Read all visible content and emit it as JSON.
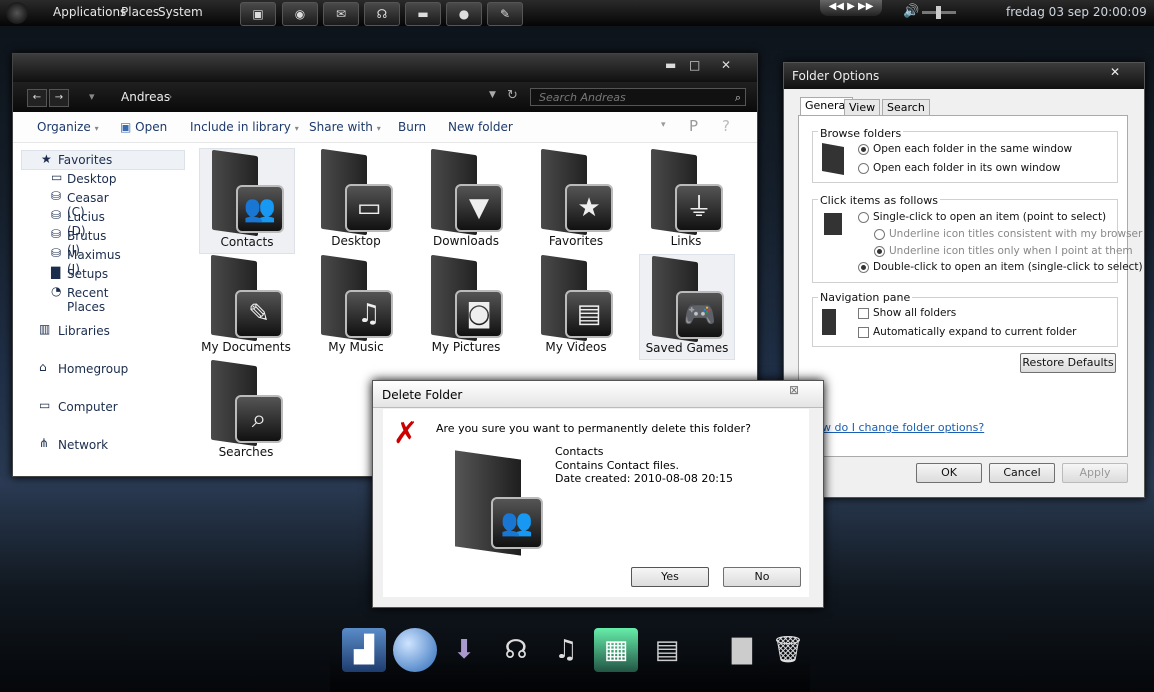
{
  "panel": {
    "menus": [
      "Applications",
      "Places",
      "System"
    ],
    "launcher_icons": [
      "home-folder-icon",
      "firefox-icon",
      "mail-icon",
      "headphones-icon",
      "folder-icon",
      "chat-icon",
      "tool-icon"
    ],
    "clock": "fredag 03 sep  20:00:09"
  },
  "explorer": {
    "breadcrumb": "Andreas",
    "search_placeholder": "Search Andreas",
    "commands": [
      "Organize",
      "Open",
      "Include in library",
      "Share with",
      "Burn",
      "New folder"
    ],
    "nav": {
      "favorites": "Favorites",
      "favorites_items": [
        "Desktop",
        "Ceasar (C)",
        "Lucius (D)",
        "Brutus (I)",
        "Maximus (J)",
        "Setups",
        "Recent Places"
      ],
      "libraries": "Libraries",
      "homegroup": "Homegroup",
      "computer": "Computer",
      "network": "Network"
    },
    "folders": [
      {
        "label": "Contacts",
        "icon": "people"
      },
      {
        "label": "Desktop",
        "icon": "monitor"
      },
      {
        "label": "Downloads",
        "icon": "download"
      },
      {
        "label": "Favorites",
        "icon": "star"
      },
      {
        "label": "Links",
        "icon": "plug"
      },
      {
        "label": "My Documents",
        "icon": "pen"
      },
      {
        "label": "My Music",
        "icon": "note"
      },
      {
        "label": "My Pictures",
        "icon": "camera"
      },
      {
        "label": "My Videos",
        "icon": "clapper"
      },
      {
        "label": "Saved Games",
        "icon": "gamepad"
      },
      {
        "label": "Searches",
        "icon": "magnifier"
      }
    ]
  },
  "folder_options": {
    "title": "Folder Options",
    "tabs": [
      "General",
      "View",
      "Search"
    ],
    "browse": {
      "title": "Browse folders",
      "opt1": "Open each folder in the same window",
      "opt2": "Open each folder in its own window"
    },
    "click": {
      "title": "Click items as follows",
      "opt1": "Single-click to open an item (point to select)",
      "sub1": "Underline icon titles consistent with my browser",
      "sub2": "Underline icon titles only when I point at them",
      "opt2": "Double-click to open an item (single-click to select)"
    },
    "navpane": {
      "title": "Navigation pane",
      "opt1": "Show all folders",
      "opt2": "Automatically expand to current folder"
    },
    "restore": "Restore Defaults",
    "help_link": "w do I change folder options?",
    "ok": "OK",
    "cancel": "Cancel",
    "apply": "Apply"
  },
  "delete_dialog": {
    "title": "Delete Folder",
    "question": "Are you sure you want to permanently delete this folder?",
    "name": "Contacts",
    "desc": "Contains Contact files.",
    "date": "Date created: 2010-08-08 20:15",
    "yes": "Yes",
    "no": "No"
  }
}
